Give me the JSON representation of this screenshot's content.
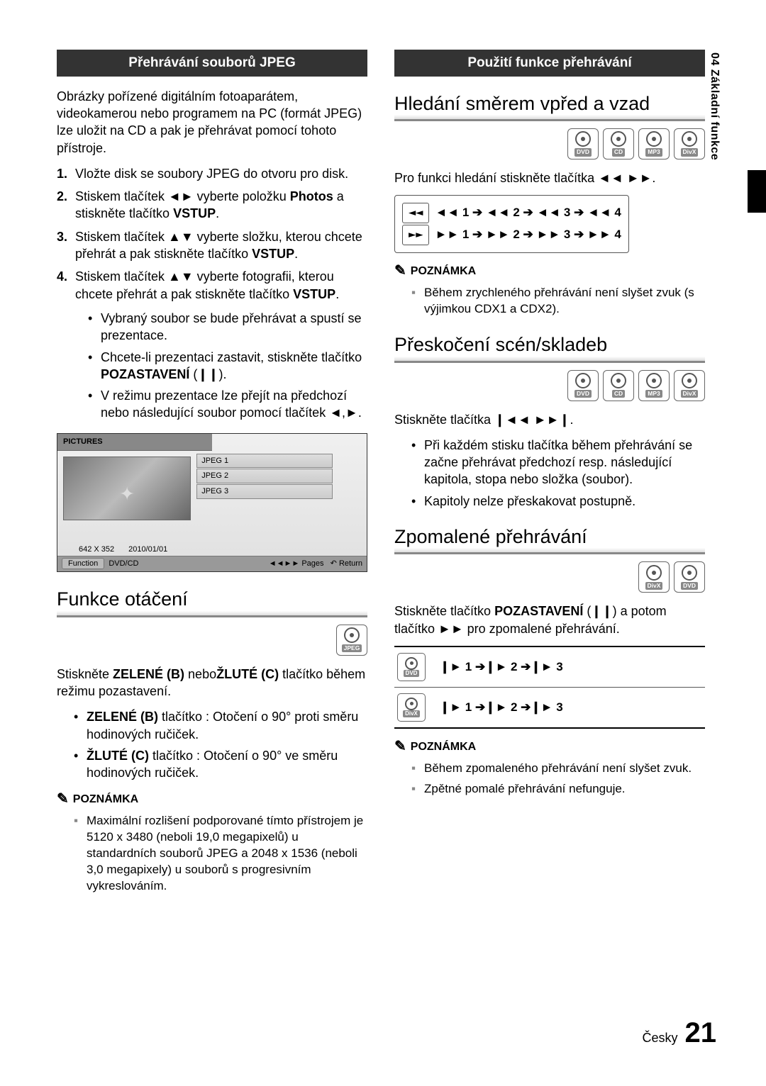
{
  "sideTab": "04  Základní funkce",
  "left": {
    "sectionBar": "Přehrávání souborů JPEG",
    "intro": "Obrázky pořízené digitálním fotoaparátem, videokamerou nebo programem na PC (formát JPEG) lze uložit na CD a pak je přehrávat pomocí tohoto přístroje.",
    "steps": {
      "s1": "Vložte disk se soubory JPEG do otvoru pro disk.",
      "s2a": "Stiskem tlačítek ◄► vyberte položku ",
      "s2b": "Photos",
      "s2c": " a stiskněte tlačítko ",
      "s2d": "VSTUP",
      "s2e": ".",
      "s3a": "Stiskem tlačítek ▲▼ vyberte složku, kterou chcete přehrát a pak stiskněte tlačítko ",
      "s3b": "VSTUP",
      "s3c": ".",
      "s4a": "Stiskem tlačítek ▲▼ vyberte fotografii, kterou chcete přehrát a pak stiskněte tlačítko ",
      "s4b": "VSTUP",
      "s4c": "."
    },
    "sub": {
      "b1": "Vybraný soubor se bude přehrávat a spustí se prezentace.",
      "b2a": "Chcete-li prezentaci zastavit, stiskněte tlačítko ",
      "b2b": "POZASTAVENÍ",
      "b2c": " (❙❙).",
      "b3": "V režimu prezentace lze přejít na předchozí nebo následující soubor pomocí tlačítek ◄,►."
    },
    "screen": {
      "title": "PICTURES",
      "files": [
        "JPEG 1",
        "JPEG 2",
        "JPEG 3"
      ],
      "res": "642 X 352",
      "date": "2010/01/01",
      "function": "Function",
      "src": "DVD/CD",
      "pages": "Pages",
      "return": "Return"
    },
    "rotation": {
      "heading": "Funkce otáčení",
      "badge": "JPEG",
      "introA": "Stiskněte ",
      "introB": "ZELENÉ (B)",
      "introC": " nebo",
      "introD": "ŽLUTÉ (C)",
      "introE": " tlačítko během režimu pozastavení.",
      "g1a": "ZELENÉ (B)",
      "g1b": " tlačítko : Otočení o 90° proti směru hodinových ručiček.",
      "y1a": "ŽLUTÉ (C)",
      "y1b": " tlačítko : Otočení o 90° ve směru hodinových ručiček.",
      "noteHead": "POZNÁMKA",
      "note": "Maximální rozlišení podporované tímto přístrojem je 5120 x 3480 (neboli 19,0 megapixelů) u standardních souborů JPEG a 2048 x 1536 (neboli 3,0 megapixely) u souborů s progresivním vykreslováním."
    }
  },
  "right": {
    "sectionBar": "Použití funkce přehrávání",
    "search": {
      "heading": "Hledání směrem vpřed a vzad",
      "badges": [
        "DVD",
        "CD",
        "MP3",
        "DivX"
      ],
      "intro": "Pro funkci hledání stiskněte tlačítka ◄◄ ►►.",
      "rwd": "◄◄ 1 ➔ ◄◄ 2 ➔ ◄◄ 3 ➔ ◄◄ 4",
      "fwd": "►► 1 ➔ ►► 2 ➔ ►► 3 ➔ ►► 4",
      "noteHead": "POZNÁMKA",
      "note": "Během zrychleného přehrávání není slyšet zvuk (s výjimkou CDX1 a CDX2)."
    },
    "skip": {
      "heading": "Přeskočení scén/skladeb",
      "badges": [
        "DVD",
        "CD",
        "MP3",
        "DivX"
      ],
      "intro": "Stiskněte tlačítka ❙◄◄ ►►❙.",
      "b1": "Při každém stisku tlačítka během přehrávání se začne přehrávat předchozí resp. následující kapitola, stopa nebo složka (soubor).",
      "b2": "Kapitoly nelze přeskakovat postupně."
    },
    "slow": {
      "heading": "Zpomalené přehrávání",
      "badges": [
        "DivX",
        "DVD"
      ],
      "introA": "Stiskněte tlačítko ",
      "introB": "POZASTAVENÍ",
      "introC": " (❙❙) a potom tlačítko ►► pro zpomalené přehrávání.",
      "rows": [
        {
          "label": "DVD",
          "seq": "❙► 1 ➔❙► 2 ➔❙► 3"
        },
        {
          "label": "DivX",
          "seq": "❙► 1 ➔❙► 2 ➔❙► 3"
        }
      ],
      "noteHead": "POZNÁMKA",
      "n1": "Během zpomaleného přehrávání není slyšet zvuk.",
      "n2": "Zpětné pomalé přehrávání nefunguje."
    }
  },
  "footer": {
    "lang": "Česky",
    "page": "21"
  }
}
